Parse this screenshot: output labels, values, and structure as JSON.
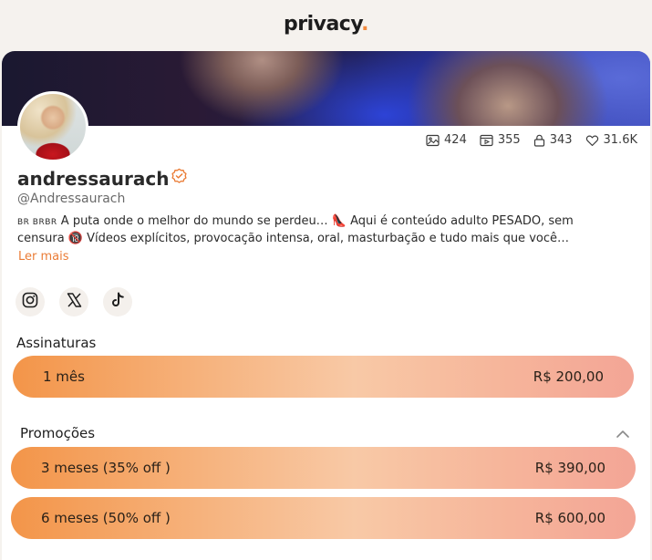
{
  "header": {
    "logo_text": "privacy",
    "logo_dot": "."
  },
  "profile": {
    "name": "andressaurach",
    "handle": "@Andressaurach",
    "verified_icon": "verified-badge-icon",
    "bio_prefix": "BR BRBR",
    "bio_text_1": " A puta onde o melhor do mundo se perdeu… 👠 Aqui é conteúdo adulto PESADO, sem",
    "bio_text_2": "censura 🔞 Vídeos explícitos, provocação intensa, oral, masturbação e tudo mais que você…",
    "more_label": "Ler mais"
  },
  "stats": {
    "images": "424",
    "videos": "355",
    "locked": "343",
    "likes": "31.6K"
  },
  "socials": [
    "instagram-icon",
    "x-icon",
    "tiktok-icon"
  ],
  "subscriptions": {
    "title": "Assinaturas",
    "plans": [
      {
        "label": "1 mês",
        "price": "R$ 200,00"
      }
    ]
  },
  "promotions": {
    "title": "Promoções",
    "plans": [
      {
        "label": "3 meses (35% off )",
        "price": "R$ 390,00"
      },
      {
        "label": "6 meses (50% off )",
        "price": "R$ 600,00"
      }
    ]
  },
  "colors": {
    "accent": "#ea7c36",
    "plan_start": "#f39549",
    "plan_end": "#f3a596"
  }
}
